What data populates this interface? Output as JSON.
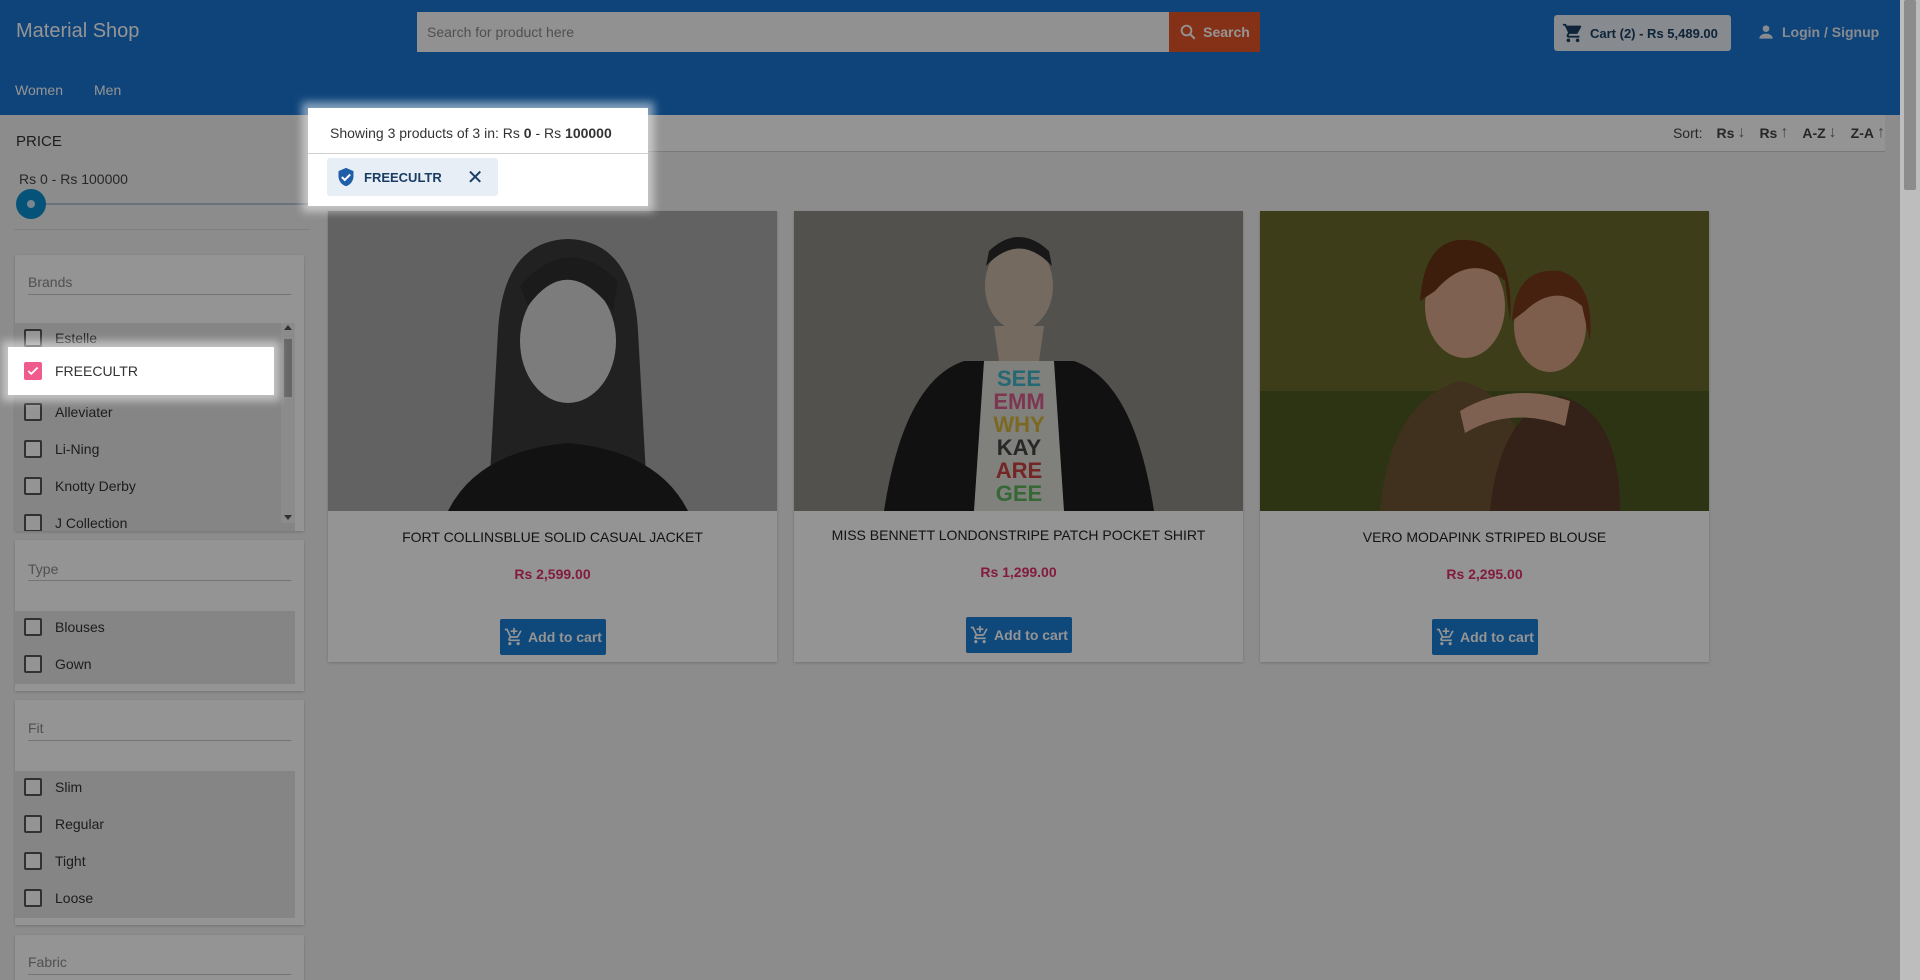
{
  "header": {
    "brand": "Material Shop",
    "search_placeholder": "Search for product here",
    "search_label": "Search",
    "cart_label": "Cart (2) - Rs 5,489.00",
    "login_label": "Login / Signup"
  },
  "nav": {
    "items": [
      "Women",
      "Men"
    ]
  },
  "sidebar": {
    "price_title": "PRICE",
    "price_range": "Rs 0 - Rs 100000",
    "slider_value_fraction": 0,
    "brands": {
      "label": "Brands",
      "options": [
        {
          "label": "Estelle",
          "checked": false
        },
        {
          "label": "FREECULTR",
          "checked": true
        },
        {
          "label": "Alleviater",
          "checked": false
        },
        {
          "label": "Li-Ning",
          "checked": false
        },
        {
          "label": "Knotty Derby",
          "checked": false
        },
        {
          "label": "J Collection",
          "checked": false
        }
      ]
    },
    "type": {
      "label": "Type",
      "options": [
        "Blouses",
        "Gown"
      ]
    },
    "fit": {
      "label": "Fit",
      "options": [
        "Slim",
        "Regular",
        "Tight",
        "Loose"
      ]
    },
    "fabric": {
      "label": "Fabric"
    }
  },
  "results": {
    "showing_prefix": "Showing 3 products of 3 in: Rs ",
    "min": "0",
    "separator": " - Rs ",
    "max": "100000",
    "sort_label": "Sort:",
    "sort_options": [
      {
        "label": "Rs",
        "dir": "↓"
      },
      {
        "label": "Rs",
        "dir": "↑"
      },
      {
        "label": "A-Z",
        "dir": "↓"
      },
      {
        "label": "Z-A",
        "dir": "↑"
      }
    ],
    "active_filter": "FREECULTR"
  },
  "products": [
    {
      "title": "FORT COLLINSBLUE SOLID CASUAL JACKET",
      "price": "Rs 2,599.00",
      "button": "Add to cart"
    },
    {
      "title": "MISS BENNETT LONDONSTRIPE PATCH POCKET SHIRT",
      "price": "Rs 1,299.00",
      "button": "Add to cart"
    },
    {
      "title": "VERO MODAPINK STRIPED BLOUSE",
      "price": "Rs 2,295.00",
      "button": "Add to cart"
    }
  ],
  "colors": {
    "primary": "#1976d2",
    "search_button": "#e65528",
    "price": "#e2306c",
    "checkbox_checked": "#f05b8d",
    "slider": "#0a8fd0"
  },
  "icons": [
    "search-icon",
    "cart-icon",
    "person-icon",
    "arrow-down-icon",
    "arrow-up-icon",
    "shield-check-icon",
    "close-icon",
    "add-cart-icon",
    "check-icon"
  ]
}
